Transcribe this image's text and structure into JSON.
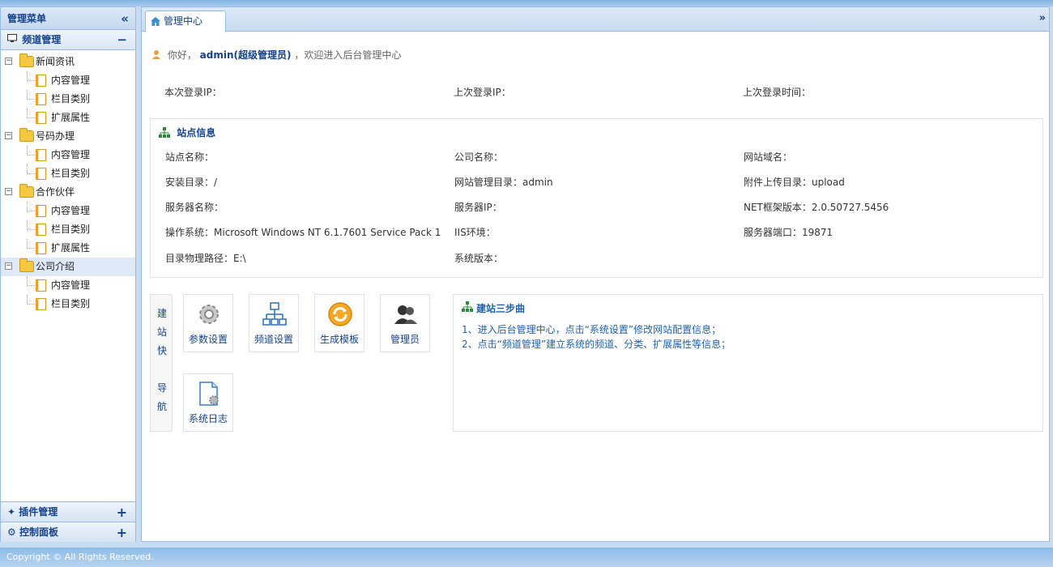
{
  "sidebar": {
    "title": "管理菜单",
    "collapse_icon": "«",
    "group": {
      "label": "频道管理",
      "toggle": "−"
    },
    "tree": [
      {
        "type": "folder",
        "label": "新闻资讯",
        "pm": "−"
      },
      {
        "type": "page",
        "label": "内容管理"
      },
      {
        "type": "page",
        "label": "栏目类别"
      },
      {
        "type": "page",
        "label": "扩展属性"
      },
      {
        "type": "folder",
        "label": "号码办理",
        "pm": "−"
      },
      {
        "type": "page",
        "label": "内容管理"
      },
      {
        "type": "page",
        "label": "栏目类别"
      },
      {
        "type": "folder",
        "label": "合作伙伴",
        "pm": "−"
      },
      {
        "type": "page",
        "label": "内容管理"
      },
      {
        "type": "page",
        "label": "栏目类别"
      },
      {
        "type": "page",
        "label": "扩展属性"
      },
      {
        "type": "folder",
        "label": "公司介绍",
        "pm": "−"
      },
      {
        "type": "page",
        "label": "内容管理"
      },
      {
        "type": "page",
        "label": "栏目类别"
      }
    ],
    "bottom": [
      {
        "label": "插件管理",
        "toggle": "+",
        "icon": "plugin-icon"
      },
      {
        "label": "控制面板",
        "toggle": "+",
        "icon": "gear-icon"
      }
    ]
  },
  "tabs": {
    "active": "管理中心",
    "more_icon": "»"
  },
  "welcome": {
    "prefix": "你好，",
    "user": "admin(超级管理员)",
    "suffix": "，欢迎进入后台管理中心"
  },
  "login": {
    "current_ip": "本次登录IP：",
    "last_ip": "上次登录IP：",
    "last_time": "上次登录时间："
  },
  "site_info": {
    "title": "站点信息",
    "site_name": "站点名称：",
    "company_name": "公司名称：",
    "domain": "网站域名：",
    "install_dir": "安装目录：/",
    "admin_dir": "网站管理目录：admin",
    "upload_dir": "附件上传目录：upload",
    "server_name": "服务器名称：",
    "server_ip": "服务器IP：",
    "net_version": "NET框架版本：2.0.50727.5456",
    "os": "操作系统：Microsoft Windows NT 6.1.7601 Service Pack 1",
    "iis": "IIS环境：",
    "port": "服务器端口：19871",
    "physical_path": "目录物理路径：E:\\",
    "system_version": "系统版本："
  },
  "quick_nav": {
    "label_chars": [
      "建",
      "站",
      "快",
      "导",
      "航"
    ],
    "buttons": [
      {
        "label": "参数设置",
        "icon": "settings-gear-icon"
      },
      {
        "label": "频道设置",
        "icon": "sitemap-icon"
      },
      {
        "label": "生成模板",
        "icon": "refresh-icon"
      },
      {
        "label": "管理员",
        "icon": "users-icon"
      },
      {
        "label": "系统日志",
        "icon": "log-file-icon"
      }
    ]
  },
  "steps": {
    "title": "建站三步曲",
    "line1": "1、进入后台管理中心，点击“系统设置”修改网站配置信息；",
    "line2": "2、点击“频道管理”建立系统的频道、分类、扩展属性等信息；"
  },
  "footer": {
    "text": "Copyright ©          All Rights Reserved."
  },
  "colors": {
    "accent": "#15428b",
    "border": "#99bbe8",
    "link": "#1d61b0",
    "folder": "#f5c842"
  }
}
